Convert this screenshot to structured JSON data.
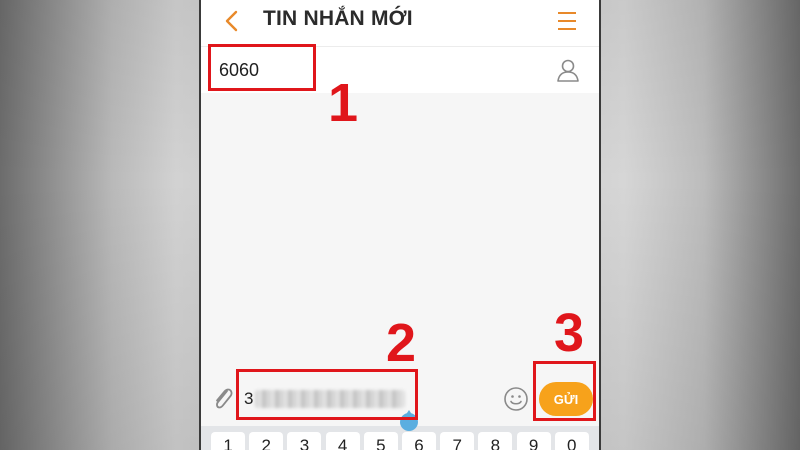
{
  "header": {
    "title": "TIN NHẮN MỚI",
    "back_icon": "chevron-left-icon",
    "menu_icon": "menu-icon"
  },
  "recipient": {
    "value": "6060",
    "contact_icon": "person-icon"
  },
  "composer": {
    "message_first_char": "3",
    "attach_icon": "paperclip-icon",
    "emoji_icon": "smiley-icon",
    "send_label": "GỬI"
  },
  "keyboard": {
    "keys": [
      "1",
      "2",
      "3",
      "4",
      "5",
      "6",
      "7",
      "8",
      "9",
      "0"
    ]
  },
  "annotations": {
    "step1": "1",
    "step2": "2",
    "step3": "3"
  },
  "colors": {
    "accent_orange": "#f7a21b",
    "icon_orange": "#e8892a",
    "annotation_red": "#e0161b",
    "cursor_blue": "#5aaee0"
  }
}
